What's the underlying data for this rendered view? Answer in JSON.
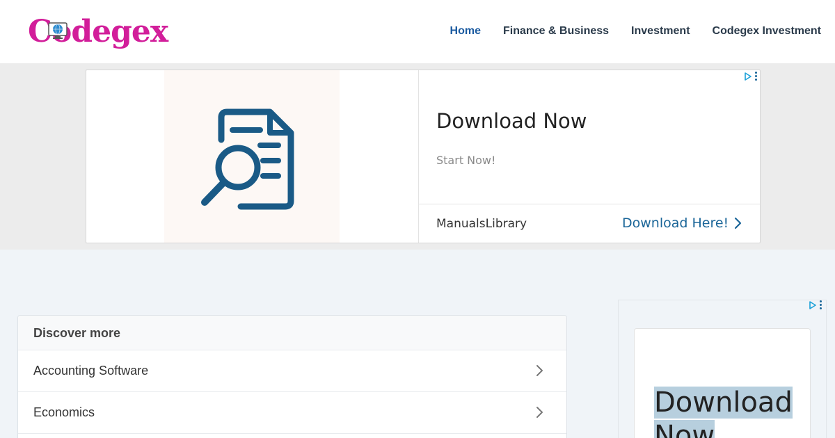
{
  "header": {
    "logo_text": "Codegex",
    "nav": [
      {
        "label": "Home",
        "active": true
      },
      {
        "label": "Finance & Business"
      },
      {
        "label": "Investment"
      },
      {
        "label": "Codegex Investment"
      }
    ]
  },
  "top_ad": {
    "title": "Download Now",
    "subtitle": "Start Now!",
    "brand": "ManualsLibrary",
    "cta": "Download Here!"
  },
  "discover": {
    "heading": "Discover more",
    "items": [
      {
        "label": "Accounting Software"
      },
      {
        "label": "Economics"
      }
    ]
  },
  "side_ad": {
    "title_line1": "Download",
    "title_line2": "Now"
  },
  "colors": {
    "brand_logo": "#d21e9a",
    "nav_active": "#1a5aa0",
    "cta_blue": "#1a6598",
    "icon_blue": "#1a5a86"
  }
}
